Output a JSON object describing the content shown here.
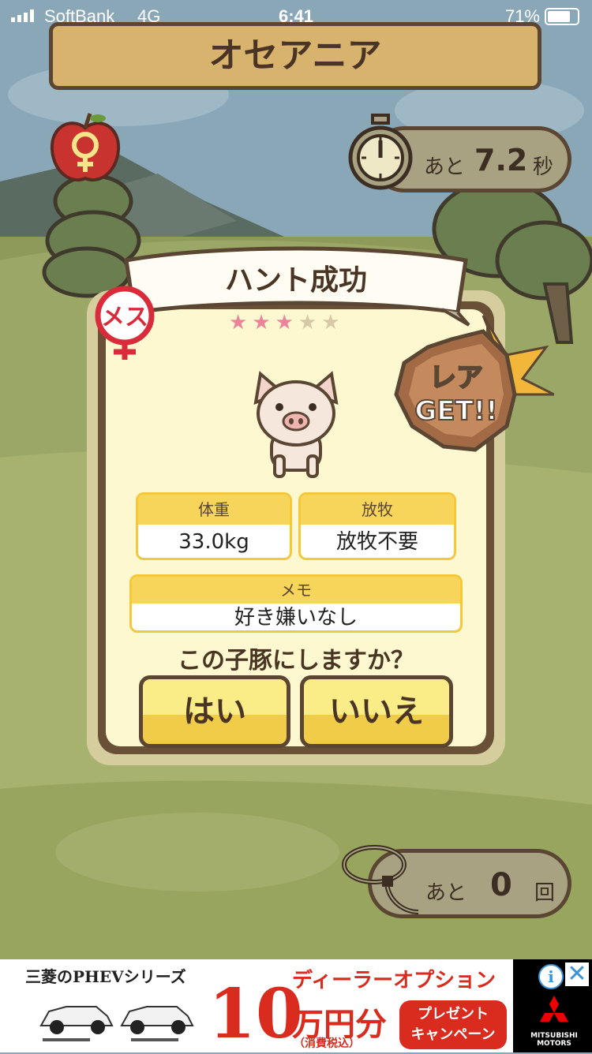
{
  "status_bar": {
    "carrier": "SoftBank",
    "network": "4G",
    "time": "6:41",
    "battery_percent": "71%"
  },
  "header": {
    "title": "オセアニア"
  },
  "timer": {
    "prefix": "あと",
    "value": "7.2",
    "unit": "秒"
  },
  "dialog": {
    "banner": "ハント成功",
    "gender_badge": "メス",
    "rarity_stars": {
      "filled": 3,
      "total": 5
    },
    "rare_badge": {
      "line1": "レア",
      "line2": "GET!!"
    },
    "weight": {
      "label": "体重",
      "value": "33.0kg"
    },
    "grazing": {
      "label": "放牧",
      "value": "放牧不要"
    },
    "memo": {
      "label": "メモ",
      "value": "好き嫌いなし"
    },
    "question": "この子豚にしますか？",
    "yes_label": "はい",
    "no_label": "いいえ"
  },
  "remaining": {
    "prefix": "あと",
    "value": "0",
    "unit": "回"
  },
  "ad": {
    "series": "三菱のPHEVシリーズ",
    "headline": "ディーラーオプション",
    "amount": "10",
    "amount_unit": "万円分",
    "tax_note": "（消費税込）",
    "cta_line1": "プレゼント",
    "cta_line2": "キャンペーン",
    "brand": "MITSUBISHI MOTORS",
    "info_label": "i",
    "close_label": "✕"
  },
  "colors": {
    "wood_dark": "#5a4632",
    "card_bg": "#fdf8cf",
    "accent_yellow": "#f7d45a",
    "star_on": "#e9859a",
    "ad_red": "#d92b1e"
  }
}
